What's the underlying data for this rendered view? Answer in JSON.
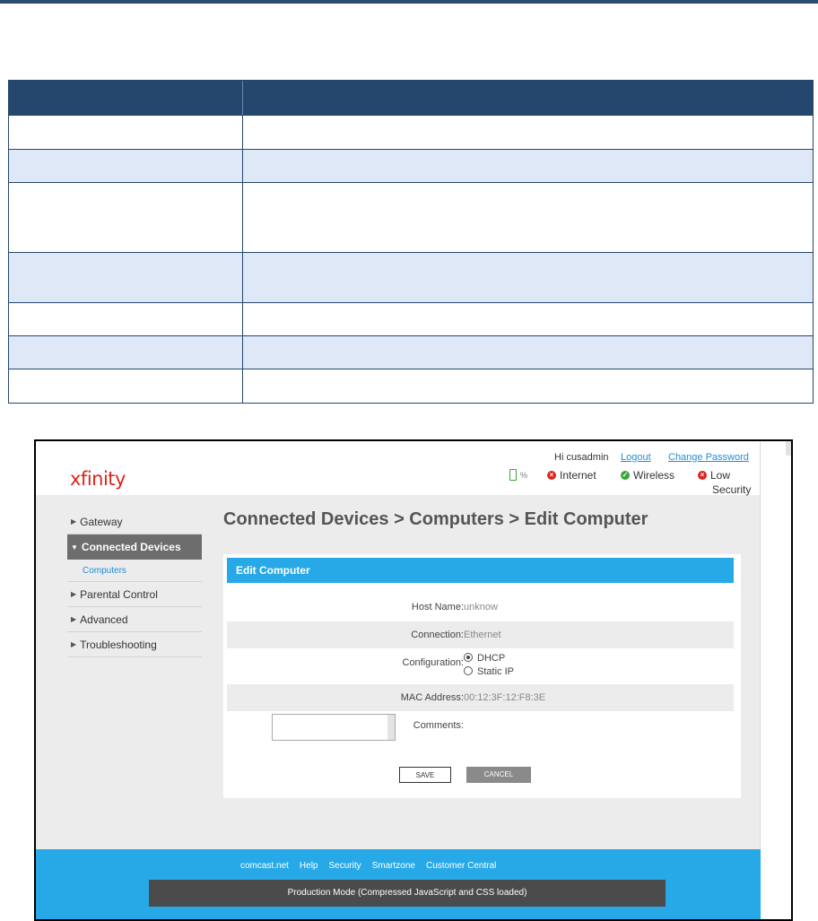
{
  "app": {
    "logo": "xfinity",
    "greeting": "Hi cusadmin",
    "logout_label": "Logout",
    "change_password_label": "Change Password",
    "battery_text": "%",
    "status": {
      "internet": "Internet",
      "wireless": "Wireless",
      "security_line1": "Low",
      "security_line2": "Security"
    }
  },
  "sidebar": {
    "items": [
      {
        "label": "Gateway"
      },
      {
        "label": "Connected Devices"
      },
      {
        "label": "Computers"
      },
      {
        "label": "Parental Control"
      },
      {
        "label": "Advanced"
      },
      {
        "label": "Troubleshooting"
      }
    ]
  },
  "main": {
    "title": "Connected Devices > Computers > Edit Computer",
    "panel_title": "Edit Computer",
    "fields": {
      "host_name_label": "Host Name:",
      "host_name_value": "unknow",
      "connection_label": "Connection:",
      "connection_value": "Ethernet",
      "configuration_label": "Configuration:",
      "configuration_options": [
        "DHCP",
        "Static IP"
      ],
      "configuration_selected": "DHCP",
      "mac_label": "MAC Address:",
      "mac_value": "00:12:3F:12:F8:3E",
      "comments_label": "Comments:",
      "comments_value": ""
    },
    "save_label": "SAVE",
    "cancel_label": "CANCEL"
  },
  "footer": {
    "links": [
      "comcast.net",
      "Help",
      "Security",
      "Smartzone",
      "Customer Central"
    ],
    "mode_text": "Production Mode (Compressed JavaScript and CSS loaded)"
  },
  "colors": {
    "table_header": "#25476d",
    "table_alt_row": "#dfe8f6",
    "accent": "#27a9e7",
    "brand_red": "#d9261c",
    "status_green": "#38a538"
  }
}
